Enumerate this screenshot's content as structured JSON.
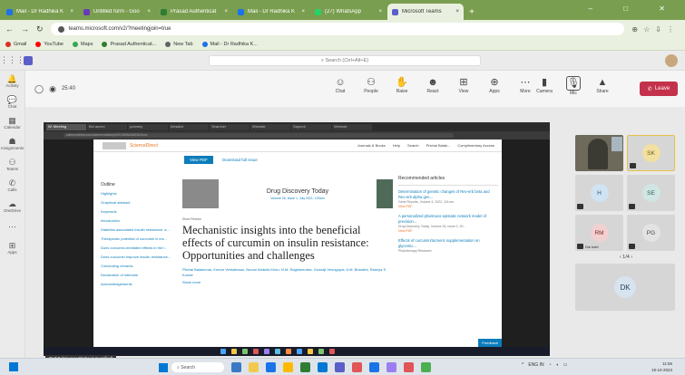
{
  "browser": {
    "tabs": [
      {
        "label": "Mail - Dr Radhika K",
        "color": "#1a73e8"
      },
      {
        "label": "Untitled form - Goo",
        "color": "#673ab7"
      },
      {
        "label": "Prasad Authenticat",
        "color": "#2e7d32"
      },
      {
        "label": "Mail - Dr Radhika K",
        "color": "#1a73e8"
      },
      {
        "label": "(27) WhatsApp",
        "color": "#25d366"
      },
      {
        "label": "Microsoft Teams",
        "color": "#5b5fc7",
        "active": true
      }
    ],
    "url": "teams.microsoft.com/v2/?meetingjoin=true",
    "bookmarks": [
      {
        "label": "Gmail",
        "color": "#d93025"
      },
      {
        "label": "YouTube",
        "color": "#ff0000"
      },
      {
        "label": "Maps",
        "color": "#34a853"
      },
      {
        "label": "Prasad Authenticat...",
        "color": "#2e7d32"
      },
      {
        "label": "New Tab",
        "color": "#5f6368"
      },
      {
        "label": "Mail - Dr Radhika K...",
        "color": "#1a73e8"
      }
    ]
  },
  "teams": {
    "search_placeholder": "Search (Ctrl+Alt+E)",
    "rail": [
      {
        "label": "Activity",
        "icon": "🔔"
      },
      {
        "label": "Chat",
        "icon": "💬"
      },
      {
        "label": "Calendar",
        "icon": "▦"
      },
      {
        "label": "Assignments",
        "icon": "☗"
      },
      {
        "label": "Teams",
        "icon": "⚇"
      },
      {
        "label": "Calls",
        "icon": "✆"
      },
      {
        "label": "OneDrive",
        "icon": "☁"
      },
      {
        "label": "",
        "icon": "⋯"
      },
      {
        "label": "Apps",
        "icon": "⊞"
      }
    ],
    "timer": "25:40",
    "tools": [
      {
        "label": "Chat",
        "icon": "☺"
      },
      {
        "label": "People",
        "icon": "⚇"
      },
      {
        "label": "Raise",
        "icon": "✋"
      },
      {
        "label": "React",
        "icon": "☻"
      },
      {
        "label": "View",
        "icon": "⊞"
      },
      {
        "label": "Apps",
        "icon": "⊕"
      },
      {
        "label": "More",
        "icon": "⋯"
      }
    ],
    "devices": [
      {
        "label": "Camera",
        "icon": "▮"
      },
      {
        "label": "Mic",
        "icon": "🎙"
      },
      {
        "label": "Share",
        "icon": "▲"
      }
    ],
    "leave": "Leave",
    "pager": "1/4",
    "participants": [
      {
        "initials": "",
        "video": true
      },
      {
        "initials": "SK",
        "bg": "#f1e0a0",
        "fg": "#6b5a1a",
        "speaking": true
      },
      {
        "initials": "H",
        "bg": "#cfe3f2",
        "fg": "#2a5a7a"
      },
      {
        "initials": "SE",
        "bg": "#d0e6e2",
        "fg": "#2a5a55"
      },
      {
        "initials": "RM",
        "bg": "#f2d0d0",
        "fg": "#7a2a2a",
        "name": "Dis hold"
      },
      {
        "initials": "PG",
        "bg": "#e3e3e3",
        "fg": "#444"
      },
      {
        "initials": "DK",
        "bg": "#d8e3f0",
        "fg": "#2a3f5a"
      }
    ],
    "presenter": "Prof Balakumar Pitchai (Unverified)"
  },
  "shared": {
    "inner_tabs": [
      "W: Meeting",
      "Bnl acnex",
      "pubmey",
      "Intradict",
      "Searcher",
      "Wentale",
      "Sapumi",
      "Wentole"
    ],
    "inner_url": "sciencedirect.com/science/article/pii/S1359644620304xxx",
    "site_name": "ScienceDirect",
    "site_nav": [
      "Journals & Books",
      "Help",
      "Search",
      "Prichai Balak...",
      "Complimentary Access"
    ],
    "view_pdf": "View PDF",
    "download": "Download full issue",
    "outline_heading": "Outline",
    "outline": [
      "Highlights",
      "Graphical abstract",
      "Keywords",
      "Introduction",
      "Diabetes-associated insulin resistance: a...",
      "Therapeutic potential of curcumin in ins...",
      "Does curcumin-mediated effects in the i...",
      "Does curcumin improve insulin resistance...",
      "Concluding remarks",
      "Declaration of interests",
      "Acknowledgements"
    ],
    "journal": "Drug Discovery Today",
    "journal_vol": "Volume 26, Issue 1, July 2021, 103xxx",
    "article_type": "Short Review",
    "title": "Mechanistic insights into the beneficial effects of curcumin on insulin resistance: Opportunities and challenges",
    "authors": "Pitchai Balakumar, Kumar Venkatesan, Noorul Abdulla Khan, N.M. Raghavendra, Gowraji Venugopal, A.M. Bharathi, Ramiya S Kumar",
    "show_more": "Show more",
    "recs_heading": "Recommended articles",
    "recs": [
      {
        "title": "Determination of genetic changes of Rev-erb beta and Rev-erb alpha gen...",
        "meta": "Gene Reports, Volume 4, 2022, 101xxx",
        "pdf": "View PDF"
      },
      {
        "title": "A personalized pharmaco-epistatic network model of precision...",
        "meta": "Drug Discovery Today, Volume 26, Issue 2, 20...",
        "pdf": "View PDF"
      },
      {
        "title": "Effects of curcumin/turmeric supplementation on glycemic...",
        "meta": "Phytotherapy Research",
        "pdf": ""
      }
    ],
    "feedback": "Feedback"
  },
  "taskbar": {
    "search": "Search",
    "lang": "ENG IN",
    "time": "11:56",
    "date": "19-10-2023"
  }
}
